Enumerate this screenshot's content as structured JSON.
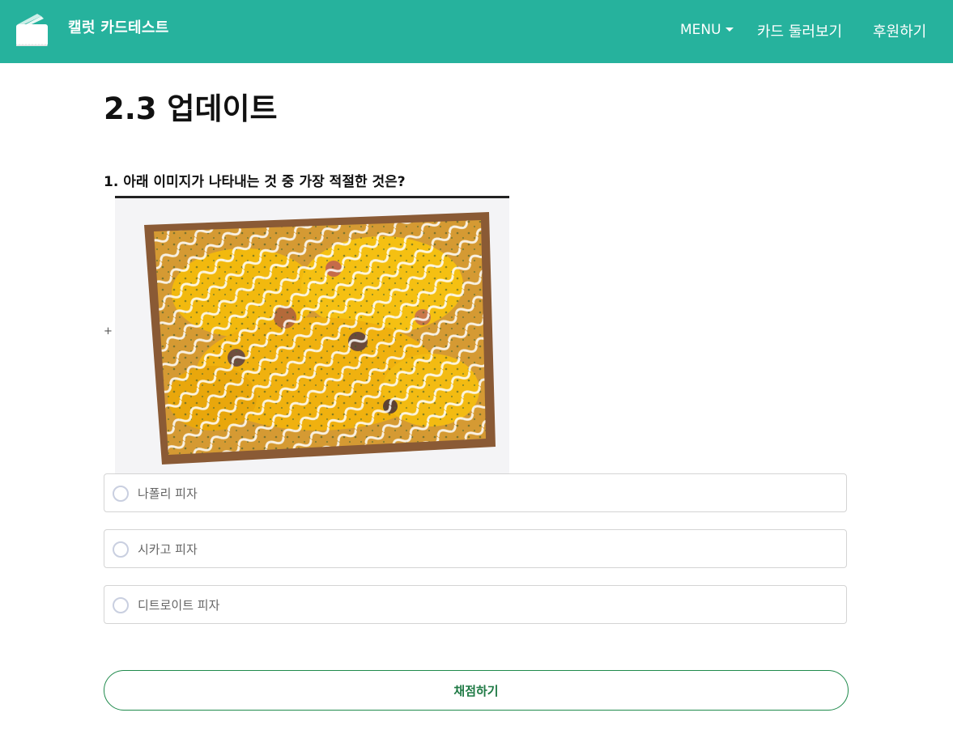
{
  "navbar": {
    "brand_title": "캘럿 카드테스트",
    "menu_label": "MENU",
    "links": [
      "카드 둘러보기",
      "후원하기"
    ],
    "background_color": "#26b29d"
  },
  "page": {
    "title": "2.3 업데이트"
  },
  "quiz": {
    "question": "1. 아래 이미지가 나타내는 것 중 가장 적절한 것은?",
    "marker": "+",
    "options": [
      "나폴리 피자",
      "시카고 피자",
      "디트로이트 피자"
    ],
    "submit_label": "채점하기",
    "accent_color": "#1f8a4c"
  }
}
